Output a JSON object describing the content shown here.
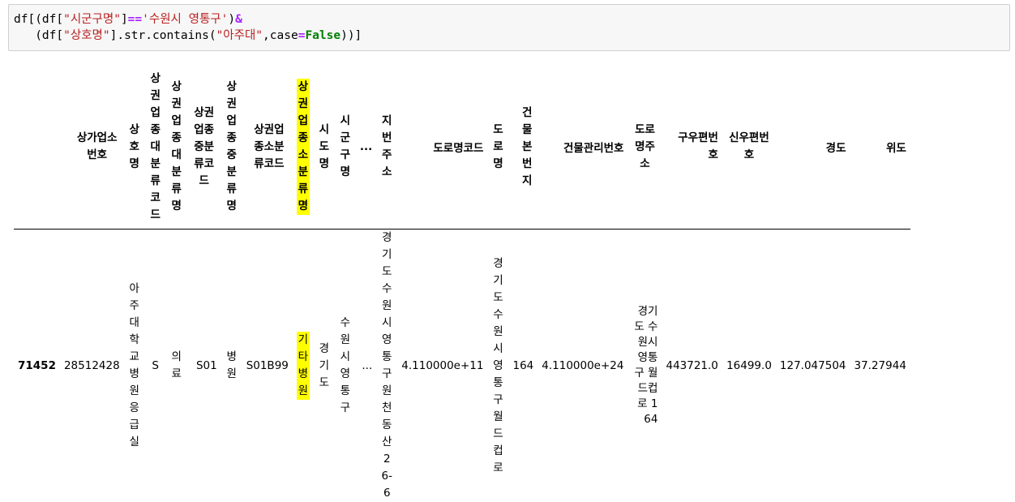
{
  "code_cell": {
    "line1": {
      "p1": "df[(df[",
      "s1": "\"시군구명\"",
      "p2": "]",
      "o1": "==",
      "s2": "'수원시 영통구'",
      "p3": ")",
      "o2": "&"
    },
    "line2": {
      "indent": "   ",
      "p1": "(df[",
      "s1": "\"상호명\"",
      "p2": "].str.contains(",
      "s2": "\"아주대\"",
      "p3": ",case",
      "o1": "=",
      "k1": "False",
      "p4": "))]"
    }
  },
  "table": {
    "columns": [
      "상가업소번호",
      "상호명",
      "상권업종대분류코드",
      "상권업종대분류명",
      "상권업종중분류코드",
      "상권업종중분류명",
      "상권업종소분류코드",
      "상권업종소분류명",
      "시도명",
      "시군구명",
      "...",
      "지번주소",
      "도로명코드",
      "도로명",
      "건물본번지",
      "건물관리번호",
      "도로명주소",
      "구우편번호",
      "신우편번호",
      "경도",
      "위도"
    ],
    "highlighted_column": "상권업종소분류명",
    "highlight_color": "#ffff00",
    "rows": [
      {
        "index": "71452",
        "cells": [
          "28512428",
          "아주대학교병원응급실",
          "S",
          "의료",
          "S01",
          "병원",
          "S01B99",
          "기타병원",
          "경기도",
          "수원시영통구",
          "...",
          "경기도수원시영통구원천동산26-6",
          "4.110000e+11",
          "경기도수원시영통구월드컵로",
          "164",
          "4.110000e+24",
          "경기도 수원시 영통구 월드컵로 164",
          "443721.0",
          "16499.0",
          "127.047504",
          "37.27944"
        ]
      }
    ]
  }
}
